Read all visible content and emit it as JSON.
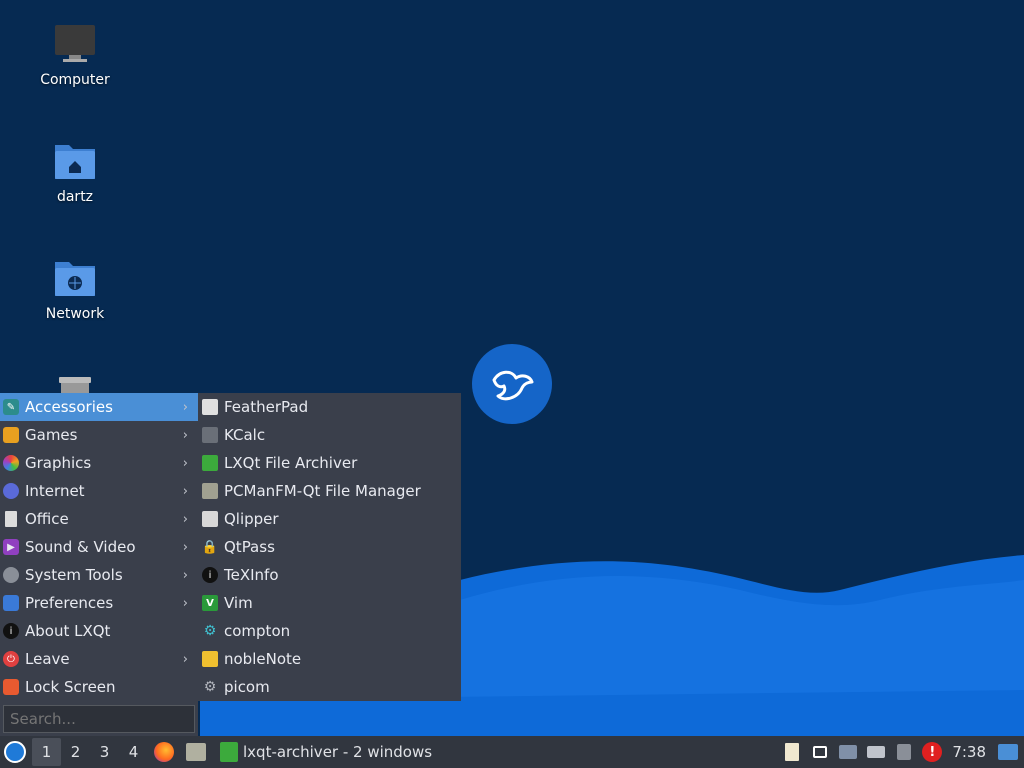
{
  "desktop": {
    "icons": [
      {
        "label": "Computer",
        "icon": "monitor-icon"
      },
      {
        "label": "dartz",
        "icon": "home-folder-icon"
      },
      {
        "label": "Network",
        "icon": "network-folder-icon"
      },
      {
        "label": "Trash",
        "icon": "trash-icon"
      }
    ]
  },
  "menu": {
    "items": [
      {
        "label": "Accessories",
        "icon": "accessories-icon",
        "submenu": true
      },
      {
        "label": "Games",
        "icon": "games-icon",
        "submenu": true
      },
      {
        "label": "Graphics",
        "icon": "graphics-icon",
        "submenu": true
      },
      {
        "label": "Internet",
        "icon": "internet-icon",
        "submenu": true
      },
      {
        "label": "Office",
        "icon": "office-icon",
        "submenu": true
      },
      {
        "label": "Sound & Video",
        "icon": "sound-video-icon",
        "submenu": true
      },
      {
        "label": "System Tools",
        "icon": "system-tools-icon",
        "submenu": true
      },
      {
        "label": "Preferences",
        "icon": "preferences-icon",
        "submenu": true
      },
      {
        "label": "About LXQt",
        "icon": "info-icon",
        "submenu": false
      },
      {
        "label": "Leave",
        "icon": "power-icon",
        "submenu": true
      },
      {
        "label": "Lock Screen",
        "icon": "lock-icon",
        "submenu": false
      }
    ],
    "search_placeholder": "Search..."
  },
  "submenu": {
    "items": [
      {
        "label": "FeatherPad",
        "icon": "featherpad-icon"
      },
      {
        "label": "KCalc",
        "icon": "calculator-icon"
      },
      {
        "label": "LXQt File Archiver",
        "icon": "archiver-icon"
      },
      {
        "label": "PCManFM-Qt File Manager",
        "icon": "file-manager-icon"
      },
      {
        "label": "Qlipper",
        "icon": "clipboard-icon"
      },
      {
        "label": "QtPass",
        "icon": "password-icon"
      },
      {
        "label": "TeXInfo",
        "icon": "info-icon"
      },
      {
        "label": "Vim",
        "icon": "vim-icon"
      },
      {
        "label": "compton",
        "icon": "gear-icon"
      },
      {
        "label": "nobleNote",
        "icon": "note-icon"
      },
      {
        "label": "picom",
        "icon": "gear-icon"
      }
    ]
  },
  "taskbar": {
    "desktops": [
      "1",
      "2",
      "3",
      "4"
    ],
    "active_desktop": "1",
    "window_group_label": "lxqt-archiver - 2 windows",
    "clock": "7:38"
  }
}
